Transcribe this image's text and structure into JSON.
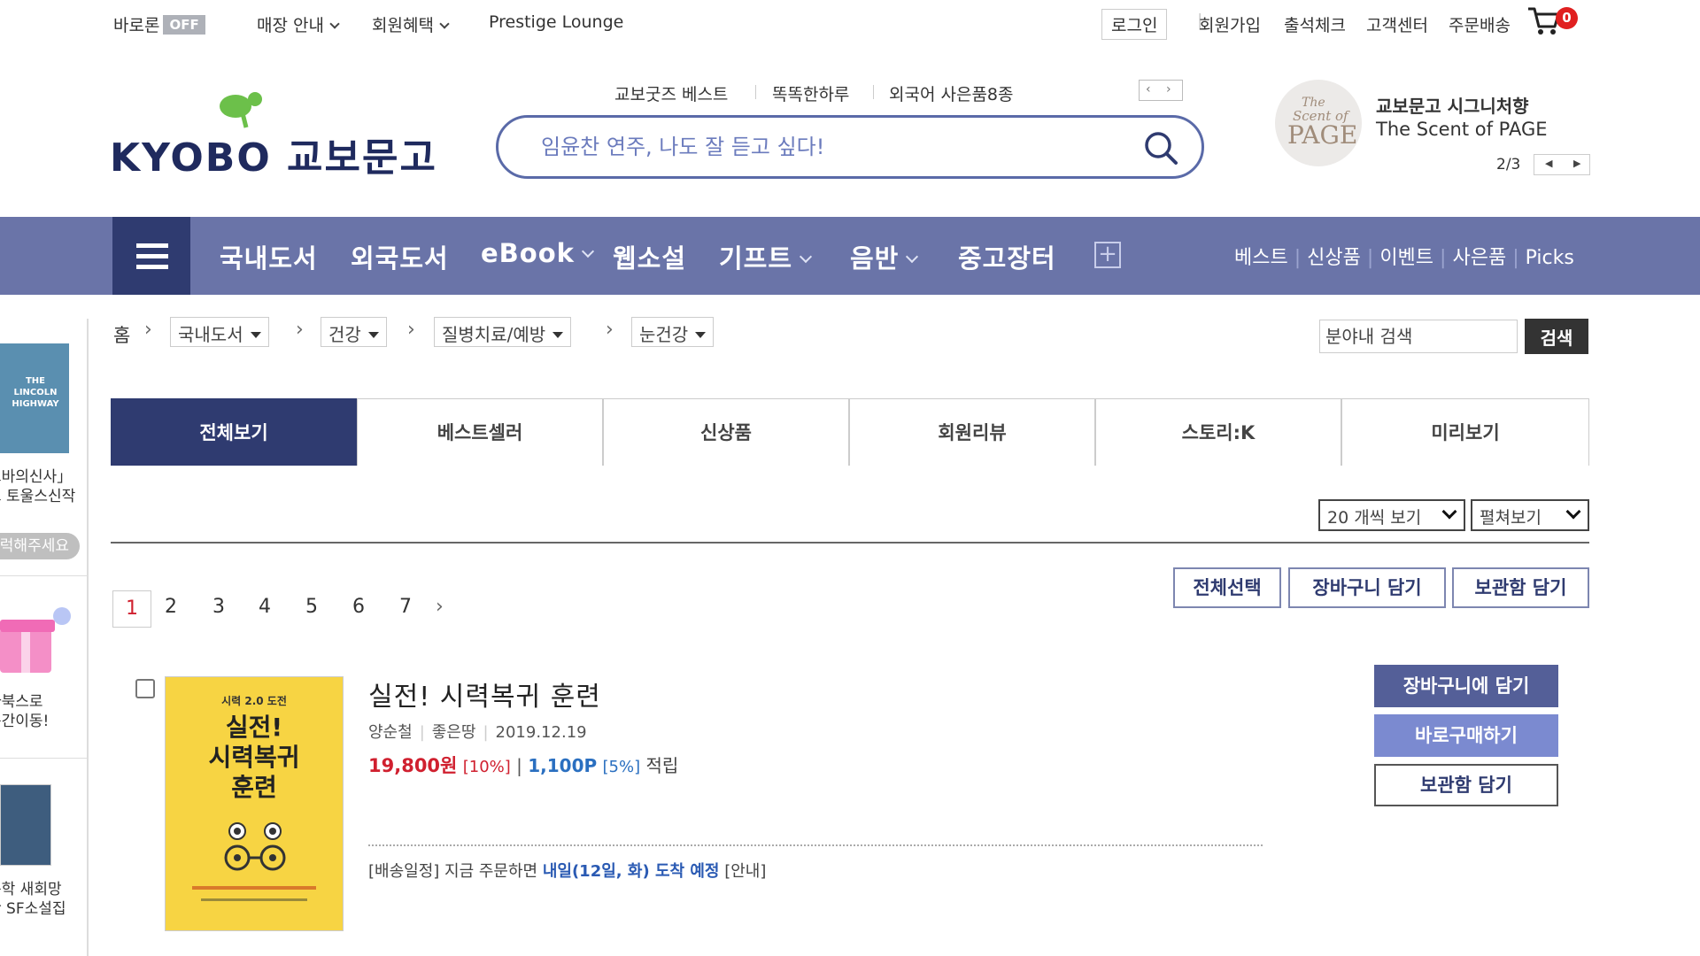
{
  "topbar": {
    "baroron": "바로론",
    "off_badge": "OFF",
    "store_info": "매장 안내",
    "member_benefit": "회원혜택",
    "prestige": "Prestige Lounge",
    "login": "로그인",
    "signup": "회원가입",
    "attendance": "출석체크",
    "customer_center": "고객센터",
    "order_delivery": "주문배송",
    "cart_count": "0"
  },
  "header": {
    "logo_text": "KYOBO 교보문고",
    "quick_links": [
      "교보굿즈 베스트",
      "똑똑한하루",
      "외국어 사은품8종"
    ],
    "search_placeholder": "임윤찬 연주, 나도 잘 듣고 싶다!",
    "promo_title": "교보문고 시그니처향",
    "promo_sub": "The Scent of PAGE",
    "promo_page": "2/3",
    "promo_logo_line1": "The",
    "promo_logo_line2": "Scent of",
    "promo_logo_line3": "PAGE"
  },
  "nav": {
    "items": [
      "국내도서",
      "외국도서",
      "eBook",
      "웹소설",
      "기프트",
      "음반",
      "중고장터"
    ],
    "right_links": [
      "베스트",
      "신상품",
      "이벤트",
      "사은품",
      "Picks"
    ]
  },
  "sidebar": {
    "items": [
      {
        "text_line1": "크바의신사」",
        "text_line2": "고 토울스신작"
      },
      {
        "pill": "럭해주세요"
      },
      {
        "text_line1": "타북스로",
        "text_line2": "순간이동!"
      },
      {
        "text_line1": "문학 새회망",
        "text_line2": "란 SF소설집"
      }
    ],
    "book_cover_text": "THE LINCOLN HIGHWAY"
  },
  "breadcrumb": {
    "home": "홈",
    "levels": [
      "국내도서",
      "건강",
      "질병치료/예방",
      "눈건강"
    ],
    "field_search_placeholder": "분야내 검색",
    "field_search_button": "검색"
  },
  "tabs": [
    "전체보기",
    "베스트셀러",
    "신상품",
    "회원리뷰",
    "스토리:K",
    "미리보기"
  ],
  "list_controls": {
    "per_page": "20 개씩 보기",
    "view_mode": "펼쳐보기",
    "select_all": "전체선택",
    "add_to_cart": "장바구니 담기",
    "add_to_wishlist": "보관함 담기"
  },
  "pagination": {
    "pages": [
      "1",
      "2",
      "3",
      "4",
      "5",
      "6",
      "7"
    ],
    "current": "1",
    "next": "›"
  },
  "product": {
    "title": "실전! 시력복귀 훈련",
    "author": "양순철",
    "publisher": "좋은땅",
    "date": "2019.12.19",
    "price": "19,800원",
    "discount": "[10%]",
    "points": "1,100P",
    "points_rate": "[5%]",
    "points_suffix": "적립",
    "ship_prefix": "[배송일정] 지금 주문하면",
    "ship_highlight": "내일(12일, 화) 도착 예정",
    "ship_suffix": "[안내]",
    "cover_top": "시력 2.0 도전",
    "cover_title_1": "실전!",
    "cover_title_2": "시력복귀",
    "cover_title_3": "훈련",
    "btn_cart": "장바구니에 담기",
    "btn_buy": "바로구매하기",
    "btn_wish": "보관함 담기"
  },
  "colors": {
    "nav_bg": "#6a74a8",
    "nav_dark": "#2f3b70",
    "price_red": "#d0202f",
    "points_blue": "#2a6fc0",
    "buy_btn": "#7b8ad0"
  }
}
